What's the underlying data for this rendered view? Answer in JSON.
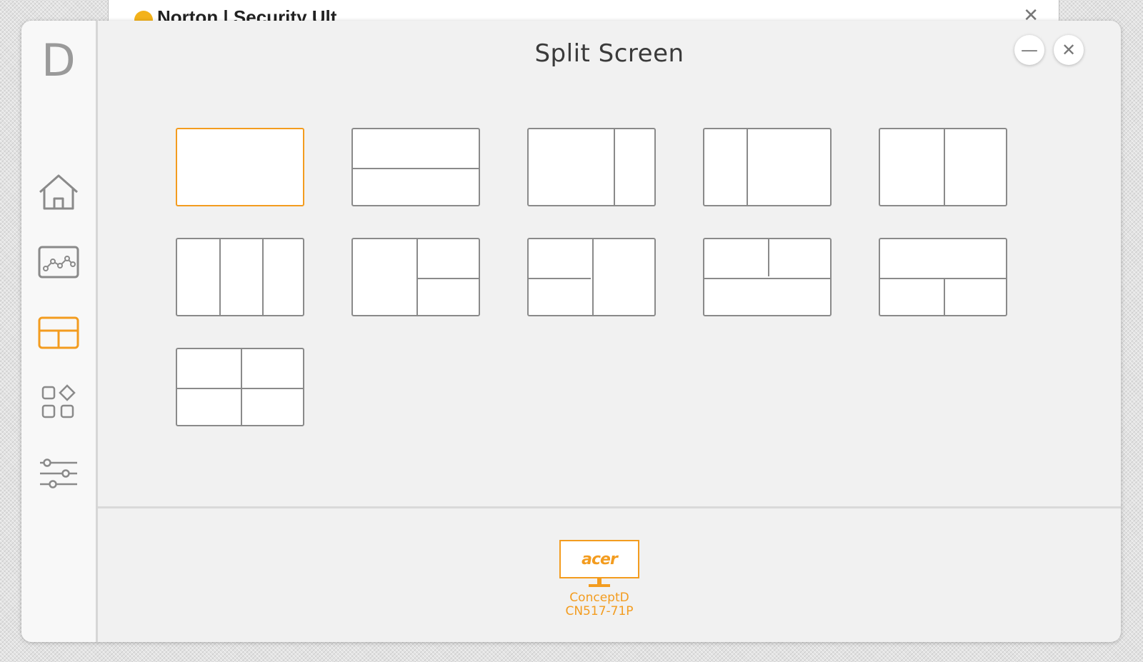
{
  "background_window": {
    "title": "Norton | Security Ult",
    "close": "✕"
  },
  "app": {
    "brand": "D",
    "title": "Split Screen",
    "minimize_label": "—",
    "close_label": "✕"
  },
  "sidebar": {
    "items": [
      {
        "name": "home",
        "icon": "home-icon",
        "active": false
      },
      {
        "name": "display",
        "icon": "chart-icon",
        "active": false
      },
      {
        "name": "split-screen",
        "icon": "split-screen-icon",
        "active": true
      },
      {
        "name": "apps",
        "icon": "apps-icon",
        "active": false
      },
      {
        "name": "settings",
        "icon": "sliders-icon",
        "active": false
      }
    ]
  },
  "layouts": [
    {
      "id": "full",
      "selected": true
    },
    {
      "id": "top-bottom",
      "selected": false
    },
    {
      "id": "left-large-right-small",
      "selected": false
    },
    {
      "id": "left-small-right-large",
      "selected": false
    },
    {
      "id": "two-equal-columns",
      "selected": false
    },
    {
      "id": "three-columns",
      "selected": false
    },
    {
      "id": "left-full-right-stacked",
      "selected": false
    },
    {
      "id": "left-stacked-right-full",
      "selected": false
    },
    {
      "id": "top-split-bottom-full",
      "selected": false
    },
    {
      "id": "top-full-bottom-split",
      "selected": false
    },
    {
      "id": "quad",
      "selected": false
    }
  ],
  "monitor": {
    "brand": "acer",
    "name_line1": "ConceptD",
    "name_line2": "CN517-71P"
  },
  "colors": {
    "accent": "#f39c1f",
    "icon_gray": "#8a8a8a",
    "background": "#f1f1f1"
  }
}
